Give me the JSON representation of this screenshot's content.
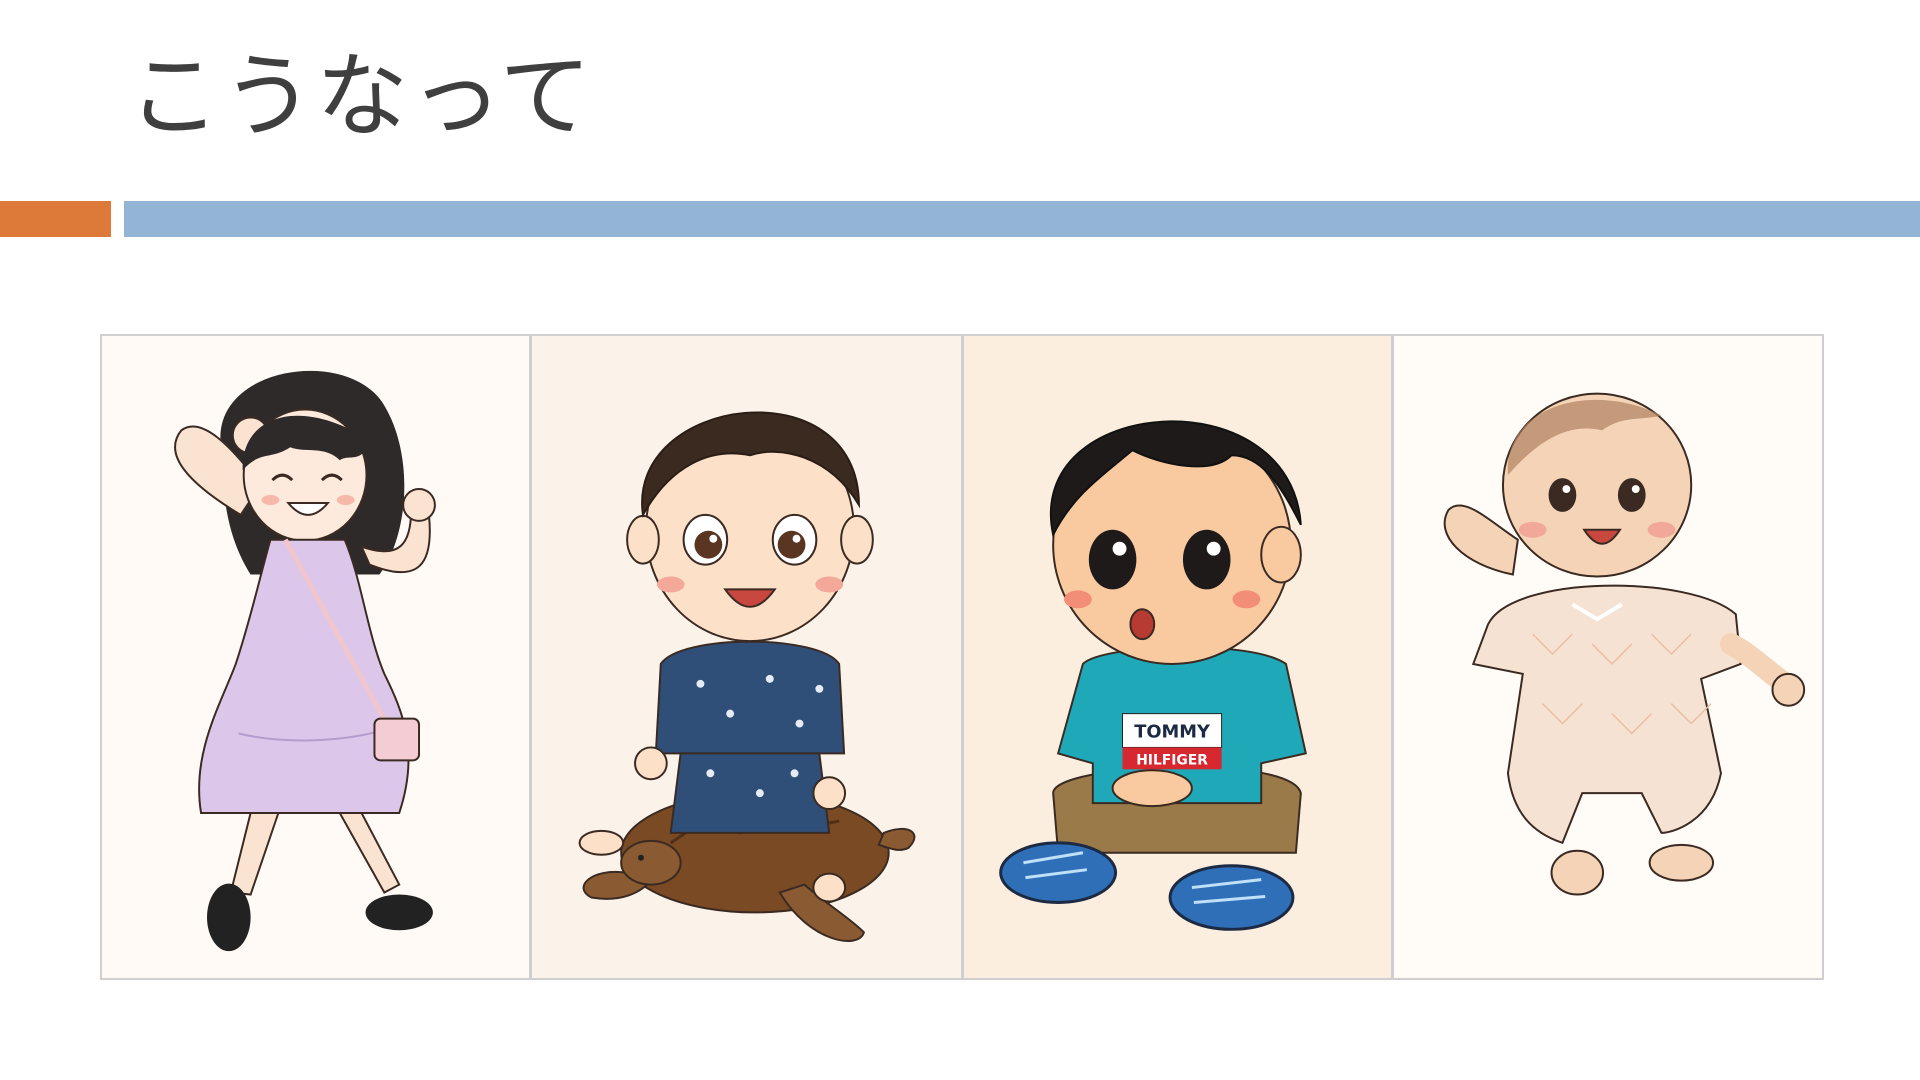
{
  "slide": {
    "title": "こうなって"
  },
  "colors": {
    "accent_orange": "#dd7a3a",
    "accent_blue": "#93b4d5",
    "title_text": "#3f3f3f"
  },
  "illustrations": [
    {
      "name": "girl-peace-sign-illustration"
    },
    {
      "name": "boy-on-sea-turtle-illustration"
    },
    {
      "name": "toddler-sitting-illustration",
      "shirt_text_line1": "TOMMY",
      "shirt_text_line2": "HILFIGER"
    },
    {
      "name": "baby-lying-illustration"
    }
  ]
}
